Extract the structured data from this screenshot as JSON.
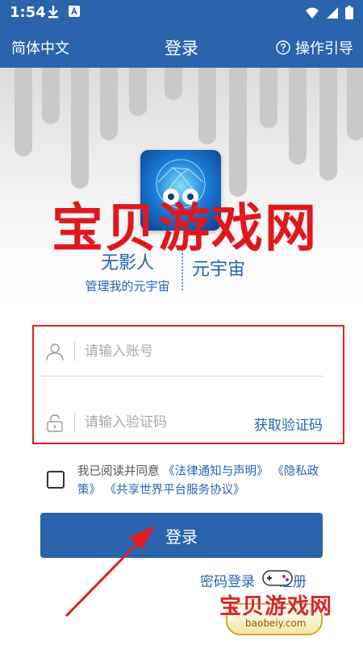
{
  "status_bar": {
    "time": "1:54"
  },
  "header": {
    "language": "简体中文",
    "title": "登录",
    "guide": "操作引导"
  },
  "brand": {
    "name": "无影人",
    "slogan": "管理我的元宇宙",
    "tagline": "元宇宙"
  },
  "watermark": {
    "overlay": "宝贝游戏网",
    "site_name": "宝贝游戏网",
    "site_url": "baobeiy.com"
  },
  "form": {
    "account_placeholder": "请输入账号",
    "code_placeholder": "请输入验证码",
    "get_code": "获取验证码"
  },
  "agreement": {
    "prefix": "我已阅读并同意",
    "links": [
      "《法律通知与声明》",
      "《隐私政策》",
      "《共享世界平台服务协议》"
    ]
  },
  "actions": {
    "login": "登录",
    "password_login": "密码登录",
    "register": "注册"
  },
  "colors": {
    "primary": "#2b63ad",
    "annotation": "#e11d22"
  }
}
